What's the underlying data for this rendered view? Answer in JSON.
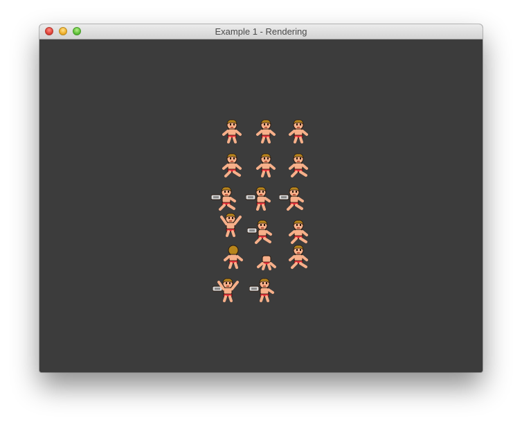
{
  "window": {
    "title": "Example 1 - Rendering"
  },
  "colors": {
    "canvas_bg": "#3c3c3c",
    "skin": "#f7b08a",
    "hair": "#b8861c",
    "trunks": "#e8303a",
    "outline": "#2a1a10",
    "gun": "#d8d8d8"
  },
  "sprites": [
    {
      "pose": "stand-front"
    },
    {
      "pose": "stand-front-eyes-closed"
    },
    {
      "pose": "stand-front-smile"
    },
    {
      "pose": "run-1"
    },
    {
      "pose": "jump"
    },
    {
      "pose": "run-2"
    },
    {
      "pose": "shoot-run-1"
    },
    {
      "pose": "shoot-jump"
    },
    {
      "pose": "shoot-run-2"
    },
    {
      "pose": "hurt-arms-up"
    },
    {
      "pose": "shoot-slide"
    },
    {
      "pose": "slide"
    },
    {
      "pose": "climb-back"
    },
    {
      "pose": "climb-top"
    },
    {
      "pose": "fall"
    },
    {
      "pose": "shoot-wave"
    },
    {
      "pose": "shoot-climb"
    }
  ]
}
